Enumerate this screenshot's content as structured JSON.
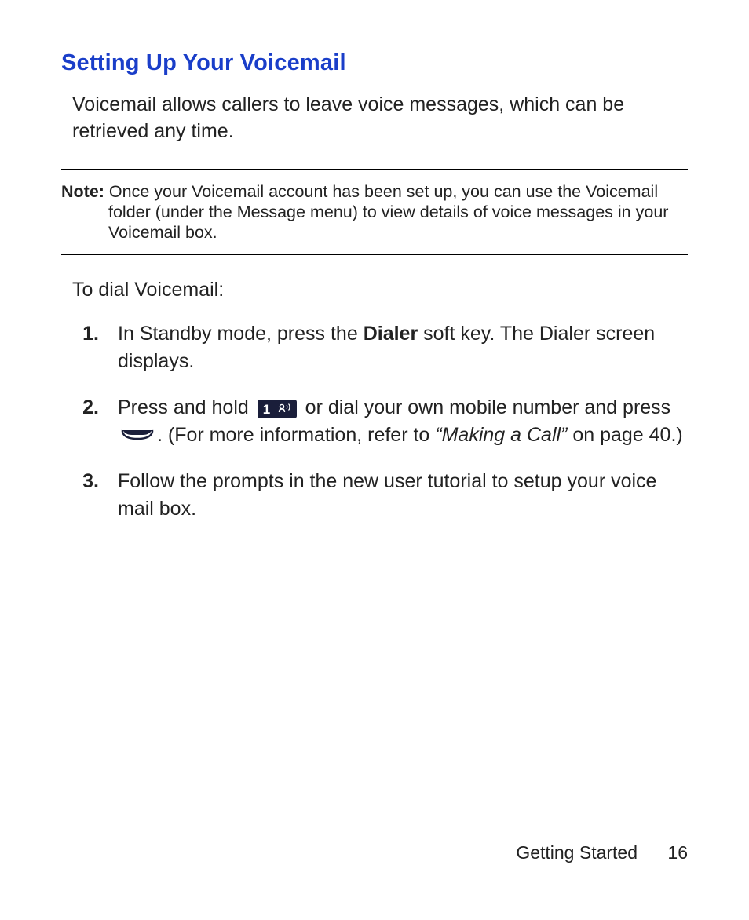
{
  "heading": "Setting Up Your Voicemail",
  "intro": "Voicemail allows callers to leave voice messages, which can be retrieved any time.",
  "note": {
    "label": "Note:",
    "text": "Once your Voicemail account has been set up, you can use the Voicemail folder (under the Message menu) to view details of voice messages in your Voicemail box."
  },
  "lead": "To dial Voicemail:",
  "steps": {
    "s1": {
      "num": "1.",
      "a": "In Standby mode, press the ",
      "dialer": "Dialer",
      "b": " soft key. The Dialer screen displays."
    },
    "s2": {
      "num": "2.",
      "a": "Press and hold ",
      "b": " or dial your own mobile number and press ",
      "c": ". (For more information, refer to ",
      "ref": "“Making a Call”",
      "d": " on page 40.)"
    },
    "s3": {
      "num": "3.",
      "text": "Follow the prompts in the new user tutorial to setup your voice mail box."
    }
  },
  "footer": {
    "section": "Getting Started",
    "page": "16"
  }
}
